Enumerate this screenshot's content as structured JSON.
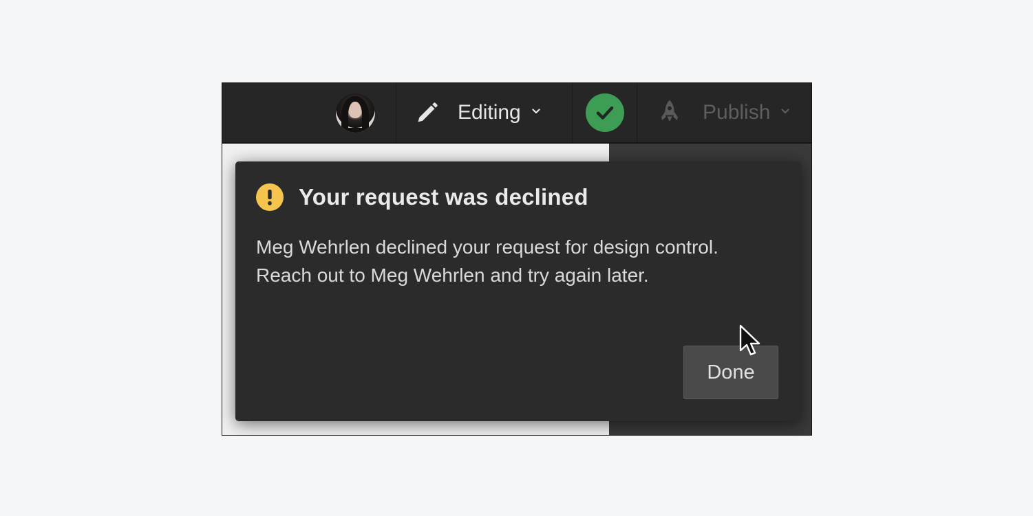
{
  "topbar": {
    "avatar_icon": "user-avatar",
    "editing_icon": "pencil-icon",
    "editing_label": "Editing",
    "status_icon": "check-icon",
    "status_color": "#3e9d54",
    "publish_icon": "rocket-icon",
    "publish_label": "Publish"
  },
  "modal": {
    "icon": "warning-icon",
    "icon_color": "#f4c44e",
    "title": "Your request was declined",
    "body": "Meg Wehrlen declined your request for design control. Reach out to Meg Wehrlen and try again later.",
    "done_label": "Done"
  }
}
